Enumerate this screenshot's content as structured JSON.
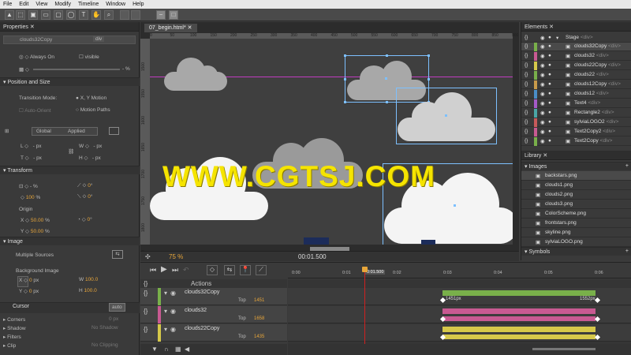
{
  "menu": [
    "File",
    "Edit",
    "View",
    "Modify",
    "Timeline",
    "Window",
    "Help"
  ],
  "properties": {
    "tab": "Properties",
    "element_name": "clouds32Copy",
    "tag": "div",
    "always_on": "Always On",
    "visible": "visible",
    "opacity_unit": "%",
    "sec_position": "Position and Size",
    "transition_mode_label": "Transition Mode:",
    "transition_opt1": "X, Y Motion",
    "transition_opt2": "Motion Paths",
    "auto_orient": "Auto-Orient",
    "global": "Global",
    "applied": "Applied",
    "l": "L",
    "t": "T",
    "w": "W",
    "h": "H",
    "px": "px",
    "sec_transform": "Transform",
    "scale_val": "100",
    "pct": "%",
    "skew_val": "0",
    "rot_val": "0",
    "origin": "Origin",
    "x": "X",
    "y": "Y",
    "origin_x": "50.00",
    "origin_y": "50.00",
    "sec_image": "Image",
    "multiple_sources": "Multiple Sources",
    "bg_image": "Background Image",
    "bg_x": "0",
    "bg_y": "0",
    "bg_w": "100.0",
    "bg_h": "100.0",
    "cursor": "Cursor",
    "cursor_val": "auto",
    "corners": "Corners",
    "corners_val": "0 px",
    "shadow": "Shadow",
    "shadow_val": "No Shadow",
    "filters": "Filters",
    "clip": "Clip",
    "clip_val": "No Clipping"
  },
  "document": {
    "tab": "07_begin.html*",
    "zoom": "75",
    "zoom_unit": "%",
    "time": "00:01.500",
    "ruler_ticks": [
      "0",
      "50",
      "100",
      "150",
      "200",
      "250",
      "300",
      "350",
      "400",
      "450",
      "500",
      "550",
      "600",
      "650",
      "700",
      "750",
      "800",
      "850",
      "900"
    ],
    "ruler_v_ticks": [
      "1500",
      "1550",
      "1600",
      "1650",
      "1700",
      "1750",
      "1800",
      "1850"
    ],
    "watermark": "WWW.CGTSJ.COM"
  },
  "elements": {
    "tab": "Elements",
    "stage": "Stage",
    "stage_tag": "<div>",
    "items": [
      {
        "name": "clouds32Copy",
        "tag": "<div>",
        "color": "#79b04a"
      },
      {
        "name": "clouds32",
        "tag": "<div>",
        "color": "#c85a92"
      },
      {
        "name": "clouds22Copy",
        "tag": "<div>",
        "color": "#d6c84a"
      },
      {
        "name": "clouds22",
        "tag": "<div>",
        "color": "#79b04a"
      },
      {
        "name": "clouds12Copy",
        "tag": "<div>",
        "color": "#c89a4a"
      },
      {
        "name": "clouds12",
        "tag": "<div>",
        "color": "#4a8ec8"
      },
      {
        "name": "Text4",
        "tag": "<div>",
        "color": "#a45ac8"
      },
      {
        "name": "Rectangle2",
        "tag": "<div>",
        "color": "#4aa6a6"
      },
      {
        "name": "sylviaLOGO2",
        "tag": "<div>",
        "color": "#c85a5a"
      },
      {
        "name": "Text2Copy2",
        "tag": "<div>",
        "color": "#c85a92"
      },
      {
        "name": "Text2Copy",
        "tag": "<div>",
        "color": "#79b04a"
      }
    ]
  },
  "library": {
    "tab": "Library",
    "images_label": "Images",
    "images": [
      "backstars.png",
      "clouds1.png",
      "clouds2.png",
      "clouds3.png",
      "ColorScheme.png",
      "frontstars.png",
      "skyline.png",
      "sylviaLOGO.png"
    ],
    "symbols_label": "Symbols"
  },
  "timeline": {
    "actions": "Actions",
    "ruler": [
      "0:00",
      "0:01",
      "0:01.500",
      "0:02",
      "0:03",
      "0:04",
      "0:05",
      "0:06"
    ],
    "layers": [
      {
        "name": "clouds32Copy",
        "prop": "Top",
        "value": "1451",
        "color": "#79b04a"
      },
      {
        "name": "clouds32",
        "prop": "Top",
        "value": "1658",
        "color": "#c85a92"
      },
      {
        "name": "clouds22Copy",
        "prop": "Top",
        "value": "1435",
        "color": "#d6c84a"
      }
    ],
    "key_start": "1451px",
    "key_end": "1552px"
  },
  "colors": {
    "accent": "#e8a63a",
    "selection": "#7dc0ff",
    "playhead": "#d02020"
  }
}
